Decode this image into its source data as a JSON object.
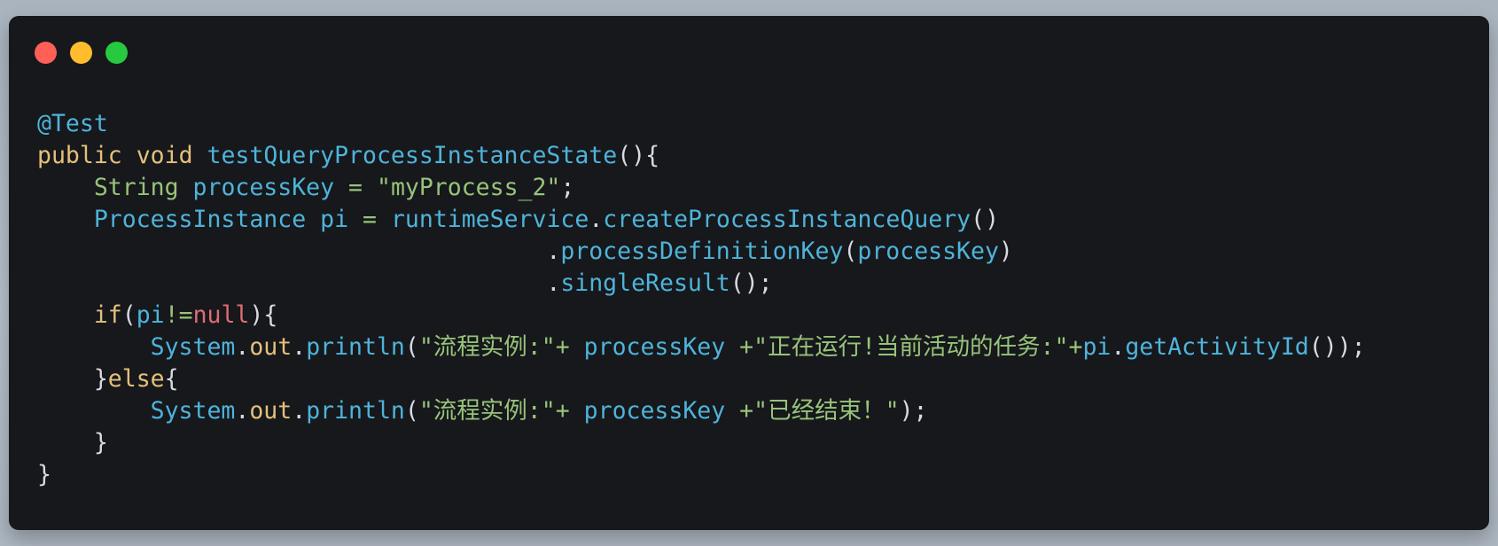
{
  "window": {
    "controls": [
      {
        "name": "close",
        "color": "#ff5f56"
      },
      {
        "name": "minimize",
        "color": "#ffbd2e"
      },
      {
        "name": "maximize",
        "color": "#27c93f"
      }
    ]
  },
  "code": {
    "language": "java",
    "lines": [
      [
        {
          "t": "ann",
          "v": "@Test"
        }
      ],
      [
        {
          "t": "kw",
          "v": "public"
        },
        {
          "t": "pun",
          "v": " "
        },
        {
          "t": "kw",
          "v": "void"
        },
        {
          "t": "pun",
          "v": " "
        },
        {
          "t": "fn",
          "v": "testQueryProcessInstanceState"
        },
        {
          "t": "pun",
          "v": "(){"
        }
      ],
      [
        {
          "t": "pun",
          "v": "    "
        },
        {
          "t": "ty",
          "v": "String"
        },
        {
          "t": "pun",
          "v": " "
        },
        {
          "t": "id",
          "v": "processKey"
        },
        {
          "t": "pun",
          "v": " "
        },
        {
          "t": "op",
          "v": "="
        },
        {
          "t": "pun",
          "v": " "
        },
        {
          "t": "str",
          "v": "\"myProcess_2\""
        },
        {
          "t": "pun",
          "v": ";"
        }
      ],
      [
        {
          "t": "pun",
          "v": "    "
        },
        {
          "t": "id",
          "v": "ProcessInstance"
        },
        {
          "t": "pun",
          "v": " "
        },
        {
          "t": "id",
          "v": "pi"
        },
        {
          "t": "pun",
          "v": " "
        },
        {
          "t": "op",
          "v": "="
        },
        {
          "t": "pun",
          "v": " "
        },
        {
          "t": "id",
          "v": "runtimeService"
        },
        {
          "t": "pun",
          "v": "."
        },
        {
          "t": "fn",
          "v": "createProcessInstanceQuery"
        },
        {
          "t": "pun",
          "v": "()"
        }
      ],
      [
        {
          "t": "pun",
          "v": "                                    ."
        },
        {
          "t": "fn",
          "v": "processDefinitionKey"
        },
        {
          "t": "pun",
          "v": "("
        },
        {
          "t": "id",
          "v": "processKey"
        },
        {
          "t": "pun",
          "v": ")"
        }
      ],
      [
        {
          "t": "pun",
          "v": "                                    ."
        },
        {
          "t": "fn",
          "v": "singleResult"
        },
        {
          "t": "pun",
          "v": "();"
        }
      ],
      [
        {
          "t": "pun",
          "v": "    "
        },
        {
          "t": "kw",
          "v": "if"
        },
        {
          "t": "pun",
          "v": "("
        },
        {
          "t": "id",
          "v": "pi"
        },
        {
          "t": "op",
          "v": "!="
        },
        {
          "t": "nul",
          "v": "null"
        },
        {
          "t": "pun",
          "v": "){"
        }
      ],
      [
        {
          "t": "pun",
          "v": "        "
        },
        {
          "t": "id",
          "v": "System"
        },
        {
          "t": "pun",
          "v": "."
        },
        {
          "t": "prop",
          "v": "out"
        },
        {
          "t": "pun",
          "v": "."
        },
        {
          "t": "fn",
          "v": "println"
        },
        {
          "t": "pun",
          "v": "("
        },
        {
          "t": "str",
          "v": "\"流程实例:\""
        },
        {
          "t": "op",
          "v": "+"
        },
        {
          "t": "pun",
          "v": " "
        },
        {
          "t": "id",
          "v": "processKey"
        },
        {
          "t": "pun",
          "v": " "
        },
        {
          "t": "op",
          "v": "+"
        },
        {
          "t": "str",
          "v": "\"正在运行!当前活动的任务:\""
        },
        {
          "t": "op",
          "v": "+"
        },
        {
          "t": "id",
          "v": "pi"
        },
        {
          "t": "pun",
          "v": "."
        },
        {
          "t": "fn",
          "v": "getActivityId"
        },
        {
          "t": "pun",
          "v": "());"
        }
      ],
      [
        {
          "t": "pun",
          "v": "    }"
        },
        {
          "t": "kw",
          "v": "else"
        },
        {
          "t": "pun",
          "v": "{"
        }
      ],
      [
        {
          "t": "pun",
          "v": "        "
        },
        {
          "t": "id",
          "v": "System"
        },
        {
          "t": "pun",
          "v": "."
        },
        {
          "t": "prop",
          "v": "out"
        },
        {
          "t": "pun",
          "v": "."
        },
        {
          "t": "fn",
          "v": "println"
        },
        {
          "t": "pun",
          "v": "("
        },
        {
          "t": "str",
          "v": "\"流程实例:\""
        },
        {
          "t": "op",
          "v": "+"
        },
        {
          "t": "pun",
          "v": " "
        },
        {
          "t": "id",
          "v": "processKey"
        },
        {
          "t": "pun",
          "v": " "
        },
        {
          "t": "op",
          "v": "+"
        },
        {
          "t": "str",
          "v": "\"已经结束！\""
        },
        {
          "t": "pun",
          "v": ");"
        }
      ],
      [
        {
          "t": "pun",
          "v": "    }"
        }
      ],
      [
        {
          "t": "pun",
          "v": "}"
        }
      ]
    ]
  }
}
